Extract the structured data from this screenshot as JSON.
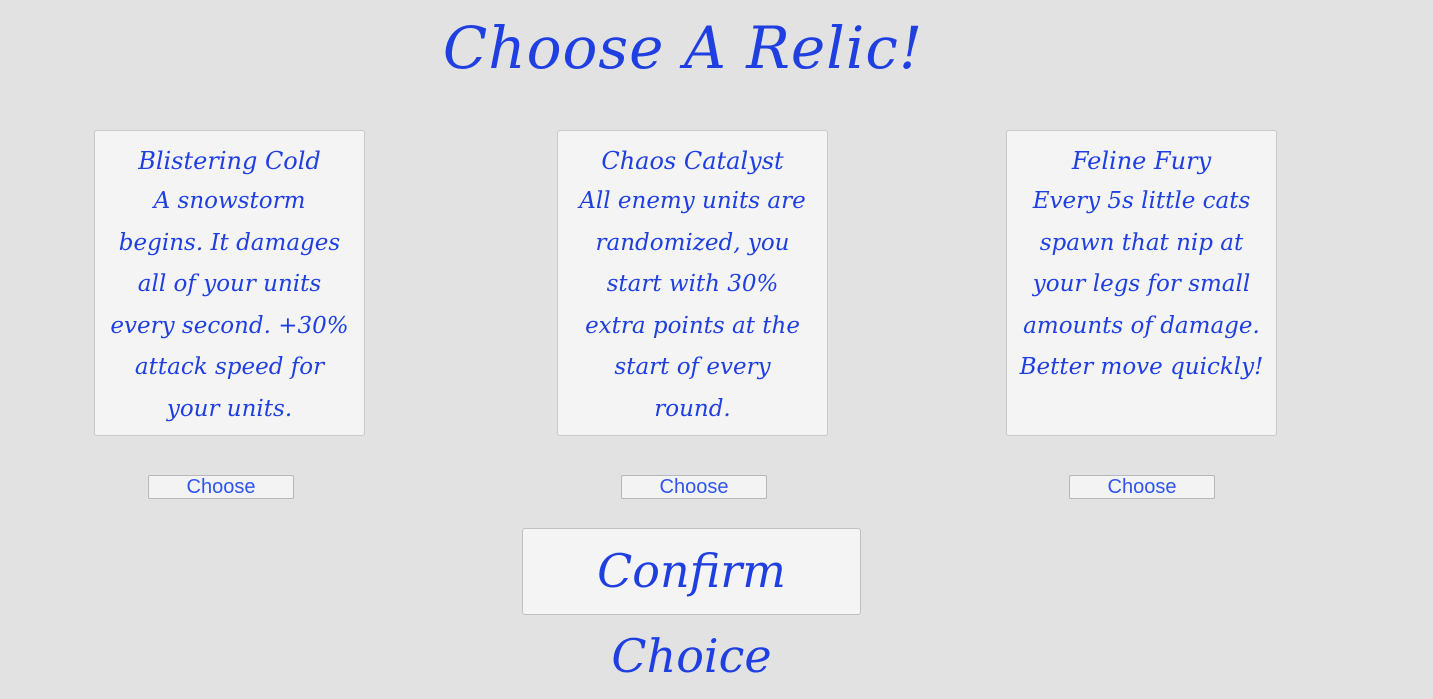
{
  "title": "Choose A Relic!",
  "relics": [
    {
      "name": "Blistering Cold",
      "description": "A snowstorm\nbegins. It damages\nall of your units\nevery second. +30%\nattack speed for\nyour units.",
      "button": "Choose"
    },
    {
      "name": "Chaos Catalyst",
      "description": "All enemy units are\nrandomized, you\nstart with 30%\nextra points at the\nstart of every\nround.",
      "button": "Choose"
    },
    {
      "name": "Feline Fury",
      "description": "Every 5s little cats\nspawn that nip at\nyour legs for small\namounts of damage.\nBetter move quickly!",
      "button": "Choose"
    }
  ],
  "confirm_label": "Confirm Choice",
  "colors": {
    "background": "#e2e2e2",
    "card": "#f4f4f4",
    "text_blue": "#1f3fe0",
    "button_text": "#2f55f0"
  }
}
